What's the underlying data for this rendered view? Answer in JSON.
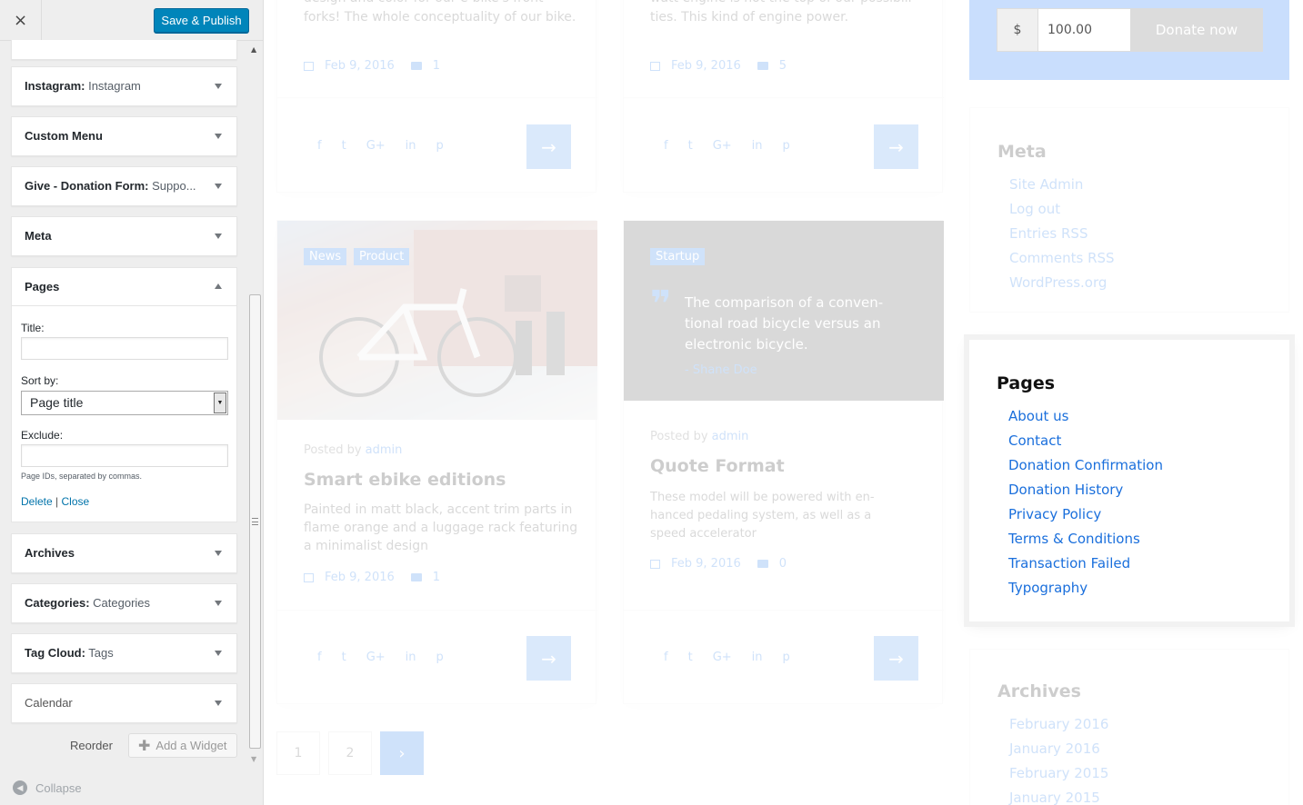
{
  "header": {
    "close_label": "×",
    "publish_label": "Save & Publish"
  },
  "widgets": [
    {
      "name": "Instagram:",
      "sub": " Instagram"
    },
    {
      "name": "Custom Menu",
      "sub": ""
    },
    {
      "name": "Give - Donation Form:",
      "sub": " Suppo..."
    },
    {
      "name": "Meta",
      "sub": ""
    }
  ],
  "widgets_after": [
    {
      "name": "Archives",
      "sub": ""
    },
    {
      "name": "Categories:",
      "sub": " Categories"
    },
    {
      "name": "Tag Cloud:",
      "sub": " Tags"
    },
    {
      "name": "Calendar",
      "sub": ""
    }
  ],
  "pages_widget": {
    "name": "Pages",
    "title_label": "Title:",
    "title_value": "",
    "sort_label": "Sort by:",
    "sort_value": "Page title",
    "exclude_label": "Exclude:",
    "exclude_value": "",
    "exclude_hint": "Page IDs, separated by commas.",
    "delete_label": "Delete",
    "separator": " | ",
    "close_label": "Close"
  },
  "footer": {
    "reorder_label": "Reorder",
    "add_widget_label": "Add a Widget",
    "collapse_label": "Collapse"
  },
  "preview": {
    "posts_top": [
      {
        "excerpt_1": "design and color for our e-bike's front",
        "excerpt_2": "forks! The whole conceptuality of our bike.",
        "date": "Feb 9, 2016",
        "comments": "1"
      },
      {
        "excerpt_1": "watt engine is not the top of our possibili-",
        "excerpt_2": "ties. This kind of engine power.",
        "date": "Feb 9, 2016",
        "comments": "5"
      }
    ],
    "post_left": {
      "tags": [
        "News",
        "Product"
      ],
      "posted_by": "Posted by ",
      "author": "admin",
      "title": "Smart ebike editions",
      "excerpt_1": "Painted in matt black, accent trim parts in",
      "excerpt_2": "flame orange and a luggage rack featuring",
      "excerpt_3": "a minimalist design",
      "date": "Feb 9, 2016",
      "comments": "1"
    },
    "post_right": {
      "tag": "Startup",
      "quote_1": "The comparison of a conven-",
      "quote_2": "tional road bicycle versus an",
      "quote_3": "electronic bicycle.",
      "quote_author": "- Shane Doe",
      "posted_by": "Posted by ",
      "author": "admin",
      "title": "Quote Format",
      "excerpt_1": "These model will be powered with en-",
      "excerpt_2": "hanced pedaling system, as well as a",
      "excerpt_3": "speed accelerator",
      "date": "Feb 9, 2016",
      "comments": "0"
    },
    "pagination": [
      "1",
      "2",
      "›"
    ],
    "donate": {
      "currency": "$",
      "amount": "100.00",
      "button": "Donate now"
    },
    "meta_widget": {
      "title": "Meta",
      "links": [
        "Site Admin",
        "Log out",
        "Entries RSS",
        "Comments RSS",
        "WordPress.org"
      ]
    },
    "pages_widget": {
      "title": "Pages",
      "links": [
        "About us",
        "Contact",
        "Donation Confirmation",
        "Donation History",
        "Privacy Policy",
        "Terms & Conditions",
        "Transaction Failed",
        "Typography"
      ]
    },
    "archives_widget": {
      "title": "Archives",
      "links": [
        "February 2016",
        "January 2016",
        "February 2015",
        "January 2015"
      ]
    }
  },
  "colors": {
    "accent": "#0085ba",
    "link": "#2b7de9",
    "donate_bg": "#c9defd"
  }
}
